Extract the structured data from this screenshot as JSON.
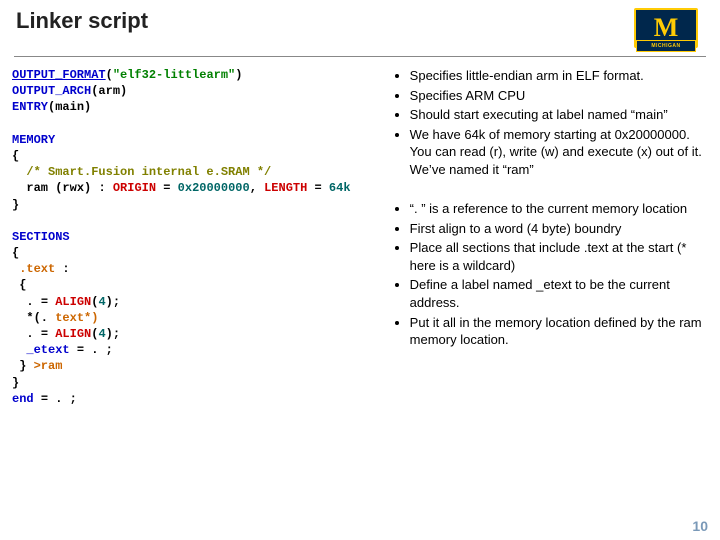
{
  "title": "Linker script",
  "logo": {
    "letter": "M",
    "banner": "MICHIGAN"
  },
  "page_number": "10",
  "code": {
    "l1a": "OUTPUT_FORMAT",
    "l1b": "(",
    "l1c": "\"elf32-littlearm\"",
    "l1d": ")",
    "l2a": "OUTPUT_ARCH",
    "l2b": "(arm)",
    "l3a": "ENTRY",
    "l3b": "(main)",
    "l4": "MEMORY",
    "l5": "{",
    "l6": "  /* Smart.Fusion internal e.SRAM */",
    "l7a": "  ram ",
    "l7b": "(rwx) ",
    "l7c": ": ",
    "l7d": "ORIGIN ",
    "l7e": "= ",
    "l7f": "0x20000000",
    "l7g": ", ",
    "l7h": "LENGTH ",
    "l7i": "= ",
    "l7j": "64k",
    "l8": "}",
    "l9": "SECTIONS",
    "l10": "{",
    "l11a": " .text ",
    "l11b": ": ",
    "l12": " {",
    "l13a": "  . ",
    "l13b": "= ",
    "l13c": "ALIGN",
    "l13d": "(",
    "l13e": "4",
    "l13f": ");",
    "l14a": "  *(. ",
    "l14b": "text*)",
    "l15a": "  . ",
    "l15b": "= ",
    "l15c": "ALIGN",
    "l15d": "(",
    "l15e": "4",
    "l15f": ");",
    "l16a": "  _etext ",
    "l16b": "= . ; ",
    "l17a": " } ",
    "l17b": ">ram",
    "l18": "}",
    "l19a": "end ",
    "l19b": "= . ; "
  },
  "notes_top": [
    "Specifies little-endian arm in ELF format.",
    "Specifies ARM CPU",
    "Should start executing at label named “main”",
    "We have 64k of memory starting at 0x20000000.  You can read (r), write (w) and execute (x) out of it.  We’ve named it “ram”"
  ],
  "notes_bottom": [
    "“. ” is a reference to the current memory location",
    "First align to a word (4 byte) boundry",
    "Place all sections that include .text at the start (* here is a wildcard)",
    "Define a label named _etext to be the current address.",
    "Put it all in the memory location defined by the ram memory location."
  ]
}
